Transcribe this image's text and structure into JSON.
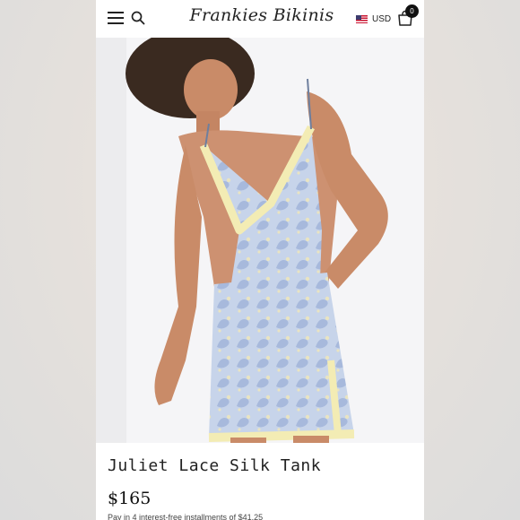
{
  "header": {
    "menu_icon": "hamburger-menu-icon",
    "search_icon": "search-icon",
    "logo_text": "Frankies Bikinis",
    "currency": "USD",
    "currency_flag": "us-flag-icon",
    "cart_icon": "shopping-bag-icon",
    "cart_count": "0"
  },
  "product": {
    "image_alt": "Model wearing blue paisley silk tank with lace trim",
    "title": "Juliet Lace Silk Tank",
    "price": "$165",
    "installments": "Pay in 4 interest-free installments of $41.25"
  },
  "colors": {
    "header_bg": "#ffffff",
    "text": "#222222",
    "badge": "#111111",
    "silk_blue": "#b9c9e2",
    "lace": "#f3ecb4"
  }
}
